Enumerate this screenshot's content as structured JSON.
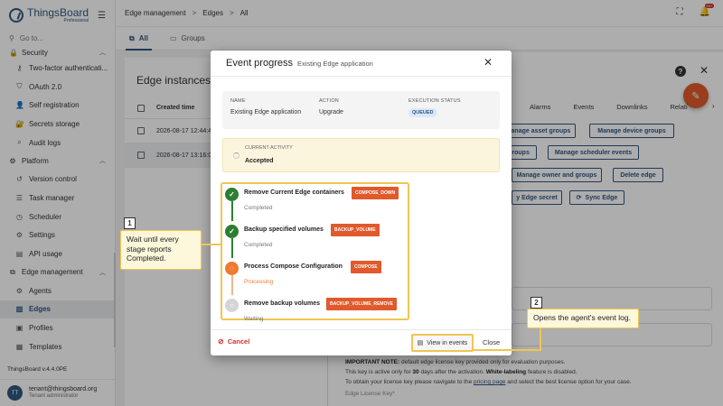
{
  "app": {
    "logo_title": "ThingsBoard",
    "logo_sub": "Professional",
    "goto_placeholder": "Go to...",
    "version": "ThingsBoard v.4.4.0PE"
  },
  "sidebar": {
    "security_group": "Security",
    "security_items": [
      {
        "label": "Two-factor authenticati...",
        "icon": "key-icon"
      },
      {
        "label": "OAuth 2.0",
        "icon": "shield-icon"
      },
      {
        "label": "Self registration",
        "icon": "person-add-icon"
      },
      {
        "label": "Secrets storage",
        "icon": "lock-icon"
      },
      {
        "label": "Audit logs",
        "icon": "search-doc-icon"
      }
    ],
    "platform_group": "Platform",
    "platform_items": [
      {
        "label": "Version control",
        "icon": "history-icon"
      },
      {
        "label": "Task manager",
        "icon": "tasks-icon"
      },
      {
        "label": "Scheduler",
        "icon": "clock-icon"
      },
      {
        "label": "Settings",
        "icon": "gear-icon"
      },
      {
        "label": "API usage",
        "icon": "chart-icon"
      }
    ],
    "edge_group": "Edge management",
    "edge_items": [
      {
        "label": "Agents",
        "icon": "agent-icon"
      },
      {
        "label": "Edges",
        "icon": "edge-icon"
      },
      {
        "label": "Profiles",
        "icon": "profile-icon"
      },
      {
        "label": "Templates",
        "icon": "template-icon"
      }
    ]
  },
  "user": {
    "initials": "TT",
    "email": "tenant@thingsboard.org",
    "role": "Tenant administrator"
  },
  "topbar": {
    "crumb1": "Edge management",
    "crumb2": "Edges",
    "crumb3": "All",
    "badge": "99+"
  },
  "tabs": [
    {
      "label": "All"
    },
    {
      "label": "Groups"
    }
  ],
  "list": {
    "title": "Edge instances",
    "col_created": "Created time",
    "rows": [
      "2026-08-17 12:44:4",
      "2026-08-17 13:16:0"
    ]
  },
  "details": {
    "tabs": [
      "Alarms",
      "Events",
      "Downlinks",
      "Relati"
    ],
    "buttons": {
      "asset_groups": "Manage asset groups",
      "device_groups": "Manage device groups",
      "groups": "groups",
      "scheduler_events": "Manage scheduler events",
      "owner_groups": "Manage owner and groups",
      "delete_edge": "Delete edge",
      "edge_secret": "y Edge secret",
      "sync_edge": "Sync Edge"
    },
    "note_bold": "IMPORTANT NOTE:",
    "note1_rest": " default edge license key provided only for evaluation purposes.",
    "note2_pre": "This key is active only for ",
    "note2_days": "30",
    "note2_mid": " days after the activation. ",
    "note2_wl": "White-labeling",
    "note2_end": " feature is disabled.",
    "note3_pre": "To obtain your license key please navigate to the ",
    "note3_link": "pricing page",
    "note3_end": " and select the best license option for your case.",
    "license_label": "Edge License Key*"
  },
  "dialog": {
    "title": "Event progress",
    "subtitle": "Existing Edge application",
    "name_label": "NAME",
    "name_value": "Existing Edge application",
    "action_label": "ACTION",
    "action_value": "Upgrade",
    "status_label": "EXECUTION STATUS",
    "status_value": "QUEUED",
    "activity_label": "CURRENT ACTIVITY",
    "activity_value": "Accepted",
    "stages": [
      {
        "name": "Remove Current Edge containers",
        "tag": "COMPOSE_DOWN",
        "status": "Completed"
      },
      {
        "name": "Backup specified volumes",
        "tag": "BACKUP_VOLUME",
        "status": "Completed"
      },
      {
        "name": "Process Compose Configuration",
        "tag": "COMPOSE",
        "status": "Processing"
      },
      {
        "name": "Remove backup volumes",
        "tag": "BACKUP_VOLUME_REMOVE",
        "status": "Waiting"
      }
    ],
    "cancel": "Cancel",
    "view_events": "View in events",
    "close": "Close"
  },
  "callouts": {
    "one_num": "1",
    "one_text": "Wait until every stage reports Completed.",
    "two_num": "2",
    "two_text": "Opens the agent's event log."
  },
  "colors": {
    "primary": "#305680",
    "accent": "#e05a2b",
    "success": "#2e7d32",
    "processing": "#ee7a30",
    "highlight": "#f0c552"
  }
}
